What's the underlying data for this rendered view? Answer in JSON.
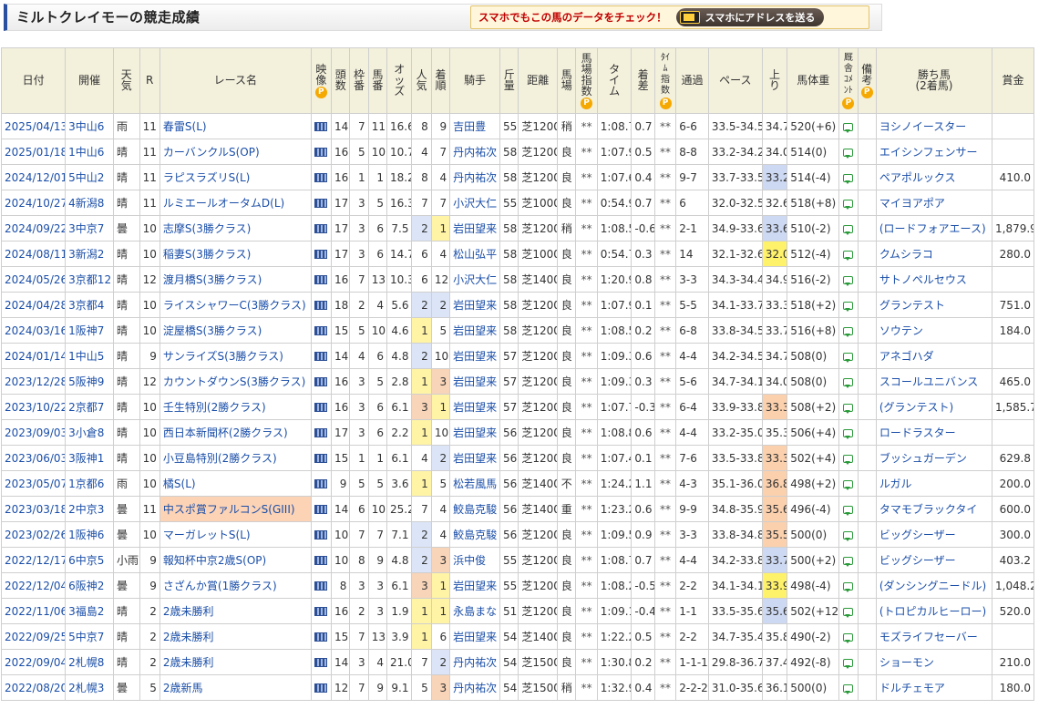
{
  "page": {
    "title": "ミルトクレイモーの競走成績",
    "promo_text": "スマホでもこの馬のデータをチェック！",
    "promo_button": "スマホにアドレスを送る"
  },
  "columns": {
    "date": "日付",
    "venue": "開催",
    "weather": [
      "天",
      "気"
    ],
    "race_no": "R",
    "race_name": "レース名",
    "video": [
      "映",
      "像"
    ],
    "runners": [
      "頭",
      "数"
    ],
    "frame": [
      "枠",
      "番"
    ],
    "horse_no": [
      "馬",
      "番"
    ],
    "odds": [
      "オ",
      "ッ",
      "ズ"
    ],
    "popularity": [
      "人",
      "気"
    ],
    "finish": [
      "着",
      "順"
    ],
    "jockey": "騎手",
    "weight_carried": [
      "斤",
      "量"
    ],
    "distance": "距離",
    "track": [
      "馬",
      "場"
    ],
    "track_index": [
      "馬",
      "場",
      "指",
      "数"
    ],
    "time": [
      "タ",
      "イ",
      "ム"
    ],
    "margin": [
      "着",
      "差"
    ],
    "time_index": [
      "ﾀｲ",
      "ﾑ",
      "指",
      "数"
    ],
    "passing": "通過",
    "pace": "ペース",
    "last3f": [
      "上",
      "り"
    ],
    "body_weight": "馬体重",
    "stable_comment": [
      "厩",
      "舎",
      "ｺﾒ",
      "ﾝﾄ"
    ],
    "remarks": [
      "備",
      "考"
    ],
    "winner_line1": "勝ち馬",
    "winner_line2": "(2着馬)",
    "prize": "賞金",
    "p_badge": "P"
  },
  "rows": [
    {
      "date": "2025/04/13",
      "venue": "3中山6",
      "weather": "雨",
      "r": "11",
      "race": "春雷S(L)",
      "runners": "14",
      "frame": "7",
      "num": "11",
      "odds": "16.6",
      "pop": "8",
      "finish": "9",
      "jockey": "吉田豊",
      "wt": "55",
      "dist": "芝1200",
      "track": "稍",
      "tidx": "**",
      "time": "1:08.7",
      "margin": "0.7",
      "timeidx": "**",
      "pass": "6-6",
      "pace": "33.5-34.5",
      "up": "34.7",
      "bw": "520(+6)",
      "winner": "ヨシノイースター",
      "prize": ""
    },
    {
      "date": "2025/01/18",
      "venue": "1中山6",
      "weather": "晴",
      "r": "11",
      "race": "カーバンクルS(OP)",
      "runners": "16",
      "frame": "5",
      "num": "10",
      "odds": "10.7",
      "pop": "4",
      "finish": "7",
      "jockey": "丹内祐次",
      "wt": "58",
      "dist": "芝1200",
      "track": "良",
      "tidx": "**",
      "time": "1:07.9",
      "margin": "0.5",
      "timeidx": "**",
      "pass": "8-8",
      "pace": "33.2-34.2",
      "up": "34.0",
      "bw": "514(0)",
      "winner": "エイシンフェンサー",
      "prize": ""
    },
    {
      "date": "2024/12/01",
      "venue": "5中山2",
      "weather": "晴",
      "r": "11",
      "race": "ラピスラズリS(L)",
      "runners": "16",
      "frame": "1",
      "num": "1",
      "odds": "18.2",
      "pop": "8",
      "finish": "4",
      "jockey": "丹内祐次",
      "wt": "58",
      "dist": "芝1200",
      "track": "良",
      "tidx": "**",
      "time": "1:07.6",
      "margin": "0.4",
      "timeidx": "**",
      "pass": "9-7",
      "pace": "33.7-33.5",
      "up": "33.2",
      "bw": "514(-4)",
      "winner": "ペアポルックス",
      "prize": "410.0",
      "uprank": 2
    },
    {
      "date": "2024/10/27",
      "venue": "4新潟8",
      "weather": "晴",
      "r": "11",
      "race": "ルミエールオータムD(L)",
      "runners": "17",
      "frame": "3",
      "num": "5",
      "odds": "16.3",
      "pop": "7",
      "finish": "7",
      "jockey": "小沢大仁",
      "wt": "55",
      "dist": "芝1000",
      "track": "良",
      "tidx": "**",
      "time": "0:54.9",
      "margin": "0.7",
      "timeidx": "**",
      "pass": "6",
      "pace": "32.0-32.5",
      "up": "32.6",
      "bw": "518(+8)",
      "winner": "マイヨアポア",
      "prize": ""
    },
    {
      "date": "2024/09/22",
      "venue": "3中京7",
      "weather": "曇",
      "r": "10",
      "race": "志摩S(3勝クラス)",
      "runners": "17",
      "frame": "3",
      "num": "6",
      "odds": "7.5",
      "pop": "2",
      "finish": "1",
      "jockey": "岩田望来",
      "wt": "58",
      "dist": "芝1200",
      "track": "稍",
      "tidx": "**",
      "time": "1:08.5",
      "margin": "-0.6",
      "timeidx": "**",
      "pass": "2-1",
      "pace": "34.9-33.6",
      "up": "33.6",
      "bw": "510(-2)",
      "winner": "(ロードフォアエース)",
      "prize": "1,879.9",
      "poprank": 2,
      "finrank": 1,
      "uprank": 2
    },
    {
      "date": "2024/08/11",
      "venue": "3新潟2",
      "weather": "晴",
      "r": "10",
      "race": "稲妻S(3勝クラス)",
      "runners": "17",
      "frame": "3",
      "num": "6",
      "odds": "14.7",
      "pop": "6",
      "finish": "4",
      "jockey": "松山弘平",
      "wt": "58",
      "dist": "芝1000",
      "track": "良",
      "tidx": "**",
      "time": "0:54.7",
      "margin": "0.3",
      "timeidx": "**",
      "pass": "14",
      "pace": "32.1-32.6",
      "up": "32.0",
      "bw": "512(-4)",
      "winner": "クムシラコ",
      "prize": "280.0",
      "uprank": 1
    },
    {
      "date": "2024/05/26",
      "venue": "3京都12",
      "weather": "晴",
      "r": "12",
      "race": "渡月橋S(3勝クラス)",
      "runners": "16",
      "frame": "7",
      "num": "13",
      "odds": "10.3",
      "pop": "6",
      "finish": "12",
      "jockey": "小沢大仁",
      "wt": "58",
      "dist": "芝1400",
      "track": "良",
      "tidx": "**",
      "time": "1:20.9",
      "margin": "0.8",
      "timeidx": "**",
      "pass": "3-3",
      "pace": "34.3-34.4",
      "up": "34.9",
      "bw": "516(-2)",
      "winner": "サトノペルセウス",
      "prize": ""
    },
    {
      "date": "2024/04/28",
      "venue": "3京都4",
      "weather": "晴",
      "r": "10",
      "race": "ライスシャワーC(3勝クラス)",
      "runners": "18",
      "frame": "2",
      "num": "4",
      "odds": "5.6",
      "pop": "2",
      "finish": "2",
      "jockey": "岩田望来",
      "wt": "58",
      "dist": "芝1200",
      "track": "良",
      "tidx": "**",
      "time": "1:07.9",
      "margin": "0.1",
      "timeidx": "**",
      "pass": "5-5",
      "pace": "34.1-33.7",
      "up": "33.3",
      "bw": "518(+2)",
      "winner": "グランテスト",
      "prize": "751.0",
      "poprank": 2,
      "finrank": 2
    },
    {
      "date": "2024/03/16",
      "venue": "1阪神7",
      "weather": "晴",
      "r": "10",
      "race": "淀屋橋S(3勝クラス)",
      "runners": "15",
      "frame": "5",
      "num": "10",
      "odds": "4.6",
      "pop": "1",
      "finish": "5",
      "jockey": "岩田望来",
      "wt": "58",
      "dist": "芝1200",
      "track": "良",
      "tidx": "**",
      "time": "1:08.5",
      "margin": "0.2",
      "timeidx": "**",
      "pass": "6-8",
      "pace": "33.8-34.5",
      "up": "33.7",
      "bw": "516(+8)",
      "winner": "ソウテン",
      "prize": "184.0",
      "poprank": 1
    },
    {
      "date": "2024/01/14",
      "venue": "1中山5",
      "weather": "晴",
      "r": "9",
      "race": "サンライズS(3勝クラス)",
      "runners": "14",
      "frame": "4",
      "num": "6",
      "odds": "4.8",
      "pop": "2",
      "finish": "10",
      "jockey": "岩田望来",
      "wt": "57",
      "dist": "芝1200",
      "track": "良",
      "tidx": "**",
      "time": "1:09.3",
      "margin": "0.6",
      "timeidx": "**",
      "pass": "4-4",
      "pace": "34.2-34.5",
      "up": "34.7",
      "bw": "508(0)",
      "winner": "アネゴハダ",
      "prize": "",
      "poprank": 2
    },
    {
      "date": "2023/12/28",
      "venue": "5阪神9",
      "weather": "晴",
      "r": "12",
      "race": "カウントダウンS(3勝クラス)",
      "runners": "16",
      "frame": "3",
      "num": "5",
      "odds": "2.8",
      "pop": "1",
      "finish": "3",
      "jockey": "岩田望来",
      "wt": "57",
      "dist": "芝1200",
      "track": "良",
      "tidx": "**",
      "time": "1:09.3",
      "margin": "0.3",
      "timeidx": "**",
      "pass": "5-6",
      "pace": "34.7-34.1",
      "up": "34.0",
      "bw": "508(0)",
      "winner": "スコールユニバンス",
      "prize": "465.0",
      "poprank": 1,
      "finrank": 3
    },
    {
      "date": "2023/10/22",
      "venue": "2京都7",
      "weather": "晴",
      "r": "10",
      "race": "壬生特別(2勝クラス)",
      "runners": "16",
      "frame": "3",
      "num": "6",
      "odds": "6.1",
      "pop": "3",
      "finish": "1",
      "jockey": "岩田望来",
      "wt": "57",
      "dist": "芝1200",
      "track": "良",
      "tidx": "**",
      "time": "1:07.7",
      "margin": "-0.3",
      "timeidx": "**",
      "pass": "6-4",
      "pace": "33.9-33.8",
      "up": "33.3",
      "bw": "508(+2)",
      "winner": "(グランテスト)",
      "prize": "1,585.7",
      "poprank": 3,
      "finrank": 1,
      "uprank": 3
    },
    {
      "date": "2023/09/03",
      "venue": "3小倉8",
      "weather": "晴",
      "r": "10",
      "race": "西日本新聞杯(2勝クラス)",
      "runners": "17",
      "frame": "3",
      "num": "6",
      "odds": "2.2",
      "pop": "1",
      "finish": "10",
      "jockey": "岩田望来",
      "wt": "56",
      "dist": "芝1200",
      "track": "良",
      "tidx": "**",
      "time": "1:08.8",
      "margin": "0.6",
      "timeidx": "**",
      "pass": "4-4",
      "pace": "33.2-35.0",
      "up": "35.3",
      "bw": "506(+4)",
      "winner": "ロードラスター",
      "prize": "",
      "poprank": 1
    },
    {
      "date": "2023/06/03",
      "venue": "3阪神1",
      "weather": "晴",
      "r": "10",
      "race": "小豆島特別(2勝クラス)",
      "runners": "15",
      "frame": "1",
      "num": "1",
      "odds": "6.1",
      "pop": "4",
      "finish": "2",
      "jockey": "岩田望来",
      "wt": "56",
      "dist": "芝1200",
      "track": "良",
      "tidx": "**",
      "time": "1:07.4",
      "margin": "0.1",
      "timeidx": "**",
      "pass": "7-6",
      "pace": "33.5-33.8",
      "up": "33.3",
      "bw": "502(+4)",
      "winner": "ブッシュガーデン",
      "prize": "629.8",
      "finrank": 2,
      "uprank": 3
    },
    {
      "date": "2023/05/07",
      "venue": "1京都6",
      "weather": "雨",
      "r": "10",
      "race": "橘S(L)",
      "runners": "9",
      "frame": "5",
      "num": "5",
      "odds": "3.6",
      "pop": "1",
      "finish": "5",
      "jockey": "松若風馬",
      "wt": "56",
      "dist": "芝1400",
      "track": "不",
      "tidx": "**",
      "time": "1:24.2",
      "margin": "1.1",
      "timeidx": "**",
      "pass": "4-3",
      "pace": "35.1-36.0",
      "up": "36.8",
      "bw": "498(+2)",
      "winner": "ルガル",
      "prize": "200.0",
      "poprank": 1,
      "uprank": 3
    },
    {
      "date": "2023/03/18",
      "venue": "2中京3",
      "weather": "曇",
      "r": "11",
      "race": "中スポ賞ファルコンS(GIII)",
      "runners": "14",
      "frame": "6",
      "num": "10",
      "odds": "25.2",
      "pop": "7",
      "finish": "4",
      "jockey": "鮫島克駿",
      "wt": "56",
      "dist": "芝1400",
      "track": "重",
      "tidx": "**",
      "time": "1:23.2",
      "margin": "0.6",
      "timeidx": "**",
      "pass": "9-9",
      "pace": "34.8-35.9",
      "up": "35.6",
      "bw": "496(-4)",
      "winner": "タマモブラックタイ",
      "prize": "600.0",
      "g3": true,
      "uprank": 3
    },
    {
      "date": "2023/02/26",
      "venue": "1阪神6",
      "weather": "曇",
      "r": "10",
      "race": "マーガレットS(L)",
      "runners": "10",
      "frame": "7",
      "num": "7",
      "odds": "7.1",
      "pop": "2",
      "finish": "4",
      "jockey": "鮫島克駿",
      "wt": "56",
      "dist": "芝1200",
      "track": "良",
      "tidx": "**",
      "time": "1:09.5",
      "margin": "0.9",
      "timeidx": "**",
      "pass": "3-3",
      "pace": "33.8-34.8",
      "up": "35.5",
      "bw": "500(0)",
      "winner": "ビッグシーザー",
      "prize": "300.0",
      "poprank": 2,
      "uprank": 3
    },
    {
      "date": "2022/12/17",
      "venue": "6中京5",
      "weather": "小雨",
      "r": "9",
      "race": "報知杯中京2歳S(OP)",
      "runners": "10",
      "frame": "8",
      "num": "9",
      "odds": "4.8",
      "pop": "2",
      "finish": "3",
      "jockey": "浜中俊",
      "wt": "55",
      "dist": "芝1200",
      "track": "良",
      "tidx": "**",
      "time": "1:08.7",
      "margin": "0.7",
      "timeidx": "**",
      "pass": "4-4",
      "pace": "34.2-33.8",
      "up": "33.7",
      "bw": "500(+2)",
      "winner": "ビッグシーザー",
      "prize": "403.2",
      "poprank": 2,
      "finrank": 3,
      "uprank": 2
    },
    {
      "date": "2022/12/04",
      "venue": "6阪神2",
      "weather": "曇",
      "r": "9",
      "race": "さざんか賞(1勝クラス)",
      "runners": "8",
      "frame": "3",
      "num": "3",
      "odds": "6.1",
      "pop": "3",
      "finish": "1",
      "jockey": "岩田望来",
      "wt": "55",
      "dist": "芝1200",
      "track": "良",
      "tidx": "**",
      "time": "1:08.2",
      "margin": "-0.5",
      "timeidx": "**",
      "pass": "2-2",
      "pace": "34.1-34.1",
      "up": "33.9",
      "bw": "498(-4)",
      "winner": "(ダンシングニードル)",
      "prize": "1,048.2",
      "poprank": 3,
      "finrank": 1,
      "uprank": 1
    },
    {
      "date": "2022/11/06",
      "venue": "3福島2",
      "weather": "晴",
      "r": "2",
      "race": "2歳未勝利",
      "runners": "16",
      "frame": "2",
      "num": "3",
      "odds": "1.9",
      "pop": "1",
      "finish": "1",
      "jockey": "永島まな",
      "wt": "51",
      "dist": "芝1200",
      "track": "良",
      "tidx": "**",
      "time": "1:09.1",
      "margin": "-0.4",
      "timeidx": "**",
      "pass": "1-1",
      "pace": "33.5-35.6",
      "up": "35.6",
      "bw": "502(+12)",
      "winner": "(トロピカルヒーロー)",
      "prize": "520.0",
      "poprank": 1,
      "finrank": 1,
      "uprank": 2
    },
    {
      "date": "2022/09/25",
      "venue": "5中京7",
      "weather": "晴",
      "r": "2",
      "race": "2歳未勝利",
      "runners": "15",
      "frame": "7",
      "num": "13",
      "odds": "3.9",
      "pop": "1",
      "finish": "6",
      "jockey": "岩田望来",
      "wt": "54",
      "dist": "芝1400",
      "track": "良",
      "tidx": "**",
      "time": "1:22.2",
      "margin": "0.5",
      "timeidx": "**",
      "pass": "2-2",
      "pace": "34.7-35.4",
      "up": "35.8",
      "bw": "490(-2)",
      "winner": "モズライフセーバー",
      "prize": "",
      "poprank": 1
    },
    {
      "date": "2022/09/04",
      "venue": "2札幌8",
      "weather": "晴",
      "r": "2",
      "race": "2歳未勝利",
      "runners": "14",
      "frame": "3",
      "num": "4",
      "odds": "21.0",
      "pop": "7",
      "finish": "2",
      "jockey": "丹内祐次",
      "wt": "54",
      "dist": "芝1500",
      "track": "良",
      "tidx": "**",
      "time": "1:30.8",
      "margin": "0.2",
      "timeidx": "**",
      "pass": "1-1-1",
      "pace": "29.8-36.7",
      "up": "37.4",
      "bw": "492(-8)",
      "winner": "ショーモン",
      "prize": "210.0",
      "finrank": 2
    },
    {
      "date": "2022/08/20",
      "venue": "2札幌3",
      "weather": "曇",
      "r": "5",
      "race": "2歳新馬",
      "runners": "12",
      "frame": "7",
      "num": "9",
      "odds": "9.1",
      "pop": "5",
      "finish": "3",
      "jockey": "丹内祐次",
      "wt": "54",
      "dist": "芝1500",
      "track": "稍",
      "tidx": "**",
      "time": "1:32.9",
      "margin": "0.4",
      "timeidx": "**",
      "pass": "2-2-2",
      "pace": "31.0-35.6",
      "up": "36.1",
      "bw": "500(0)",
      "winner": "ドルチェモア",
      "prize": "180.0",
      "finrank": 3
    }
  ]
}
